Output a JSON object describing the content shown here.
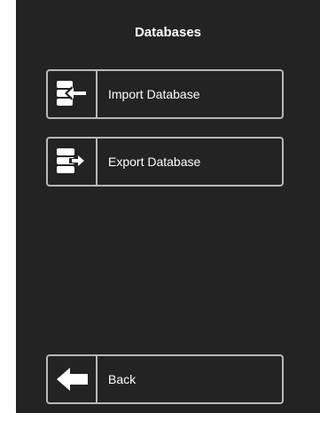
{
  "header": {
    "title": "Databases"
  },
  "menu": {
    "import_label": "Import Database",
    "export_label": "Export Database",
    "back_label": "Back"
  },
  "colors": {
    "panel_background": "#232323",
    "border": "#b8b8b8",
    "text": "#ffffff"
  },
  "icons": {
    "import": "database-import-icon",
    "export": "database-export-icon",
    "back": "back-arrow-icon"
  }
}
